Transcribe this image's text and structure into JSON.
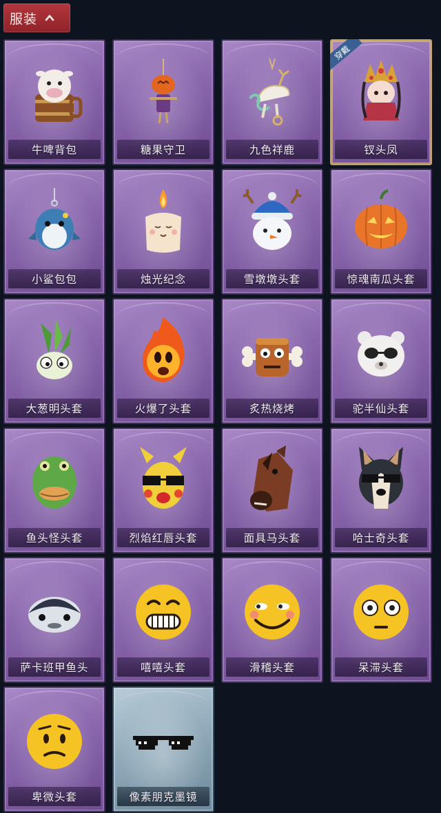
{
  "header": {
    "title": "服装"
  },
  "items": [
    {
      "label": "牛啤背包",
      "icon": "cow-beer-backpack-icon",
      "style": "purple"
    },
    {
      "label": "糖果守卫",
      "icon": "pumpkin-scarecrow-icon",
      "style": "purple"
    },
    {
      "label": "九色祥鹿",
      "icon": "deer-pendant-icon",
      "style": "purple"
    },
    {
      "label": "钗头凤",
      "icon": "phoenix-crown-doll-icon",
      "style": "gold",
      "badge": "穿戴"
    },
    {
      "label": "小鲨包包",
      "icon": "shark-bag-icon",
      "style": "purple"
    },
    {
      "label": "烛光纪念",
      "icon": "candle-icon",
      "style": "purple"
    },
    {
      "label": "雪墩墩头套",
      "icon": "snowman-head-icon",
      "style": "purple"
    },
    {
      "label": "惊魂南瓜头套",
      "icon": "jack-o-lantern-icon",
      "style": "purple"
    },
    {
      "label": "大葱明头套",
      "icon": "scallion-head-icon",
      "style": "purple"
    },
    {
      "label": "火爆了头套",
      "icon": "fire-head-icon",
      "style": "purple"
    },
    {
      "label": "炙热烧烤",
      "icon": "bbq-meat-icon",
      "style": "purple"
    },
    {
      "label": "驼半仙头套",
      "icon": "bear-sunglasses-icon",
      "style": "purple"
    },
    {
      "label": "鱼头怪头套",
      "icon": "fish-head-icon",
      "style": "purple"
    },
    {
      "label": "烈焰红唇头套",
      "icon": "yellow-mask-icon",
      "style": "purple"
    },
    {
      "label": "面具马头套",
      "icon": "horse-mask-icon",
      "style": "purple"
    },
    {
      "label": "哈士奇头套",
      "icon": "husky-head-icon",
      "style": "purple"
    },
    {
      "label": "萨卡班甲鱼头",
      "icon": "armored-fish-icon",
      "style": "purple"
    },
    {
      "label": "嘻嘻头套",
      "icon": "grin-emoji-icon",
      "style": "purple"
    },
    {
      "label": "滑稽头套",
      "icon": "funny-emoji-icon",
      "style": "purple"
    },
    {
      "label": "呆滞头套",
      "icon": "dazed-emoji-icon",
      "style": "purple"
    },
    {
      "label": "卑微头套",
      "icon": "humble-emoji-icon",
      "style": "purple"
    },
    {
      "label": "像素朋克墨镜",
      "icon": "pixel-sunglasses-icon",
      "style": "blue"
    }
  ]
}
